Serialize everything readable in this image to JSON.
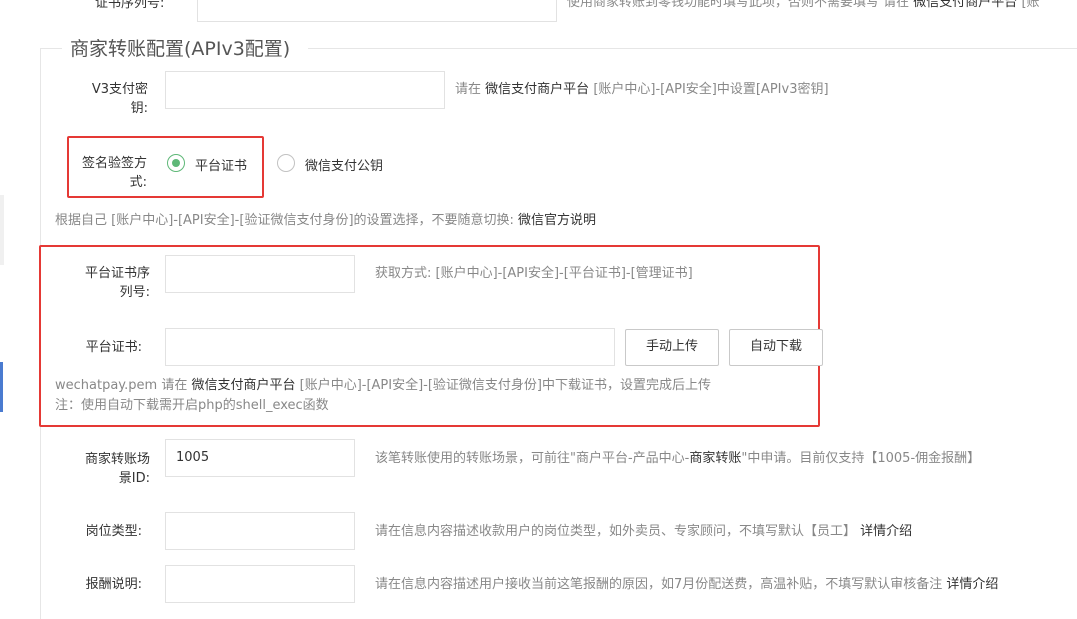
{
  "top_row": {
    "label": "证书序列号:",
    "hint": "使用商家转账到零钱功能时填写此项，否则不需要填写  请在",
    "hint_link": "微信支付商户平台",
    "hint_tail": "[账"
  },
  "section": {
    "legend": "商家转账配置(APIv3配置)"
  },
  "v3_key": {
    "label": "V3支付密钥:",
    "value": "",
    "hint_pre": "请在",
    "hint_link": "微信支付商户平台",
    "hint_post": "[账户中心]-[API安全]中设置[APIv3密钥]"
  },
  "sign_method": {
    "label": "签名验签方式:",
    "options": [
      {
        "label": "平台证书",
        "checked": true
      },
      {
        "label": "微信支付公钥",
        "checked": false
      }
    ],
    "hint_pre": "根据自己 [账户中心]-[API安全]-[验证微信支付身份]的设置选择，不要随意切换:",
    "hint_link": "微信官方说明"
  },
  "platform_serial": {
    "label": "平台证书序列号:",
    "value": "",
    "hint": "获取方式: [账户中心]-[API安全]-[平台证书]-[管理证书]"
  },
  "platform_cert": {
    "label": "平台证书:",
    "value": "",
    "upload_button": "手动上传",
    "download_button": "自动下载",
    "hint1_pre": "wechatpay.pem 请在",
    "hint1_link": "微信支付商户平台",
    "hint1_post": "[账户中心]-[API安全]-[验证微信支付身份]中下载证书，设置完成后上传",
    "hint2": "注：使用自动下载需开启php的shell_exec函数"
  },
  "scene_id": {
    "label": "商家转账场景ID:",
    "value": "1005",
    "hint_pre": "该笔转账使用的转账场景，可前往\"商户平台-产品中心-",
    "hint_link": "商家转账",
    "hint_post": "\"中申请。目前仅支持【1005-佣金报酬】"
  },
  "job_type": {
    "label": "岗位类型:",
    "value": "",
    "hint_pre": "请在信息内容描述收款用户的岗位类型，如外卖员、专家顾问，不填写默认【员工】",
    "hint_link": "详情介绍"
  },
  "reward_desc": {
    "label": "报酬说明:",
    "value": "",
    "hint_pre": "请在信息内容描述用户接收当前这笔报酬的原因，如7月份配送费，高温补贴，不填写默认审核备注",
    "hint_link": "详情介绍"
  },
  "colors": {
    "highlight_border": "#e53935",
    "radio_checked": "#5fb878",
    "sidebar_active": "#4a7bd0"
  }
}
